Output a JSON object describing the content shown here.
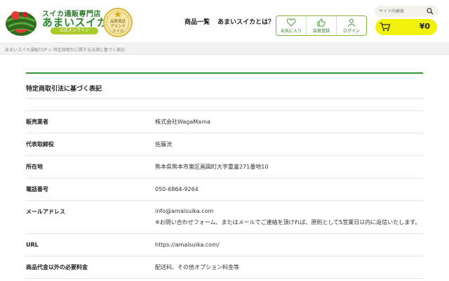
{
  "header": {
    "logo_sub": "スイカ通販専門店",
    "logo_main": "あまいスイカ",
    "logo_badge": "公式オンライン",
    "seal_lines": [
      "品質保証",
      "ブランド",
      "スイカ"
    ],
    "nav": [
      "商品一覧",
      "あまいスイカとは？"
    ],
    "icons": [
      {
        "label": "お気に入り",
        "icon": "heart-icon"
      },
      {
        "label": "会員登録",
        "icon": "thumbs-up-icon"
      },
      {
        "label": "ログイン",
        "icon": "user-icon"
      }
    ],
    "search_placeholder": "サイト内検索",
    "cart_price": "¥0"
  },
  "breadcrumb": "あまいスイカ通販TOP > 特定商取引に関する法律に基づく表記",
  "page": {
    "title": "特定商取引法に基づく表記",
    "rows": [
      {
        "key": "販売業者",
        "value": "株式会社WagaMama"
      },
      {
        "key": "代表取締役",
        "value": "佐藤洸"
      },
      {
        "key": "所在地",
        "value": "熊本県熊本市東区画図町大字重富271番地10"
      },
      {
        "key": "電話番号",
        "value": "050-6864-9264"
      },
      {
        "key": "メールアドレス",
        "value": "info@amaisuika.com",
        "note": "※お問い合わせフォーム、またはメールでご連絡を頂ければ、原則として5営業日以内に返信いたします。"
      },
      {
        "key": "URL",
        "value": "https://amaisuika.com/"
      },
      {
        "key": "商品代金以外の必要料金",
        "value": "配送料、その他オプション料金等"
      }
    ]
  },
  "colors": {
    "brand_green": "#2b8a2b",
    "cart_yellow": "#f1f10a",
    "accent_line": "#3a9a3a"
  }
}
